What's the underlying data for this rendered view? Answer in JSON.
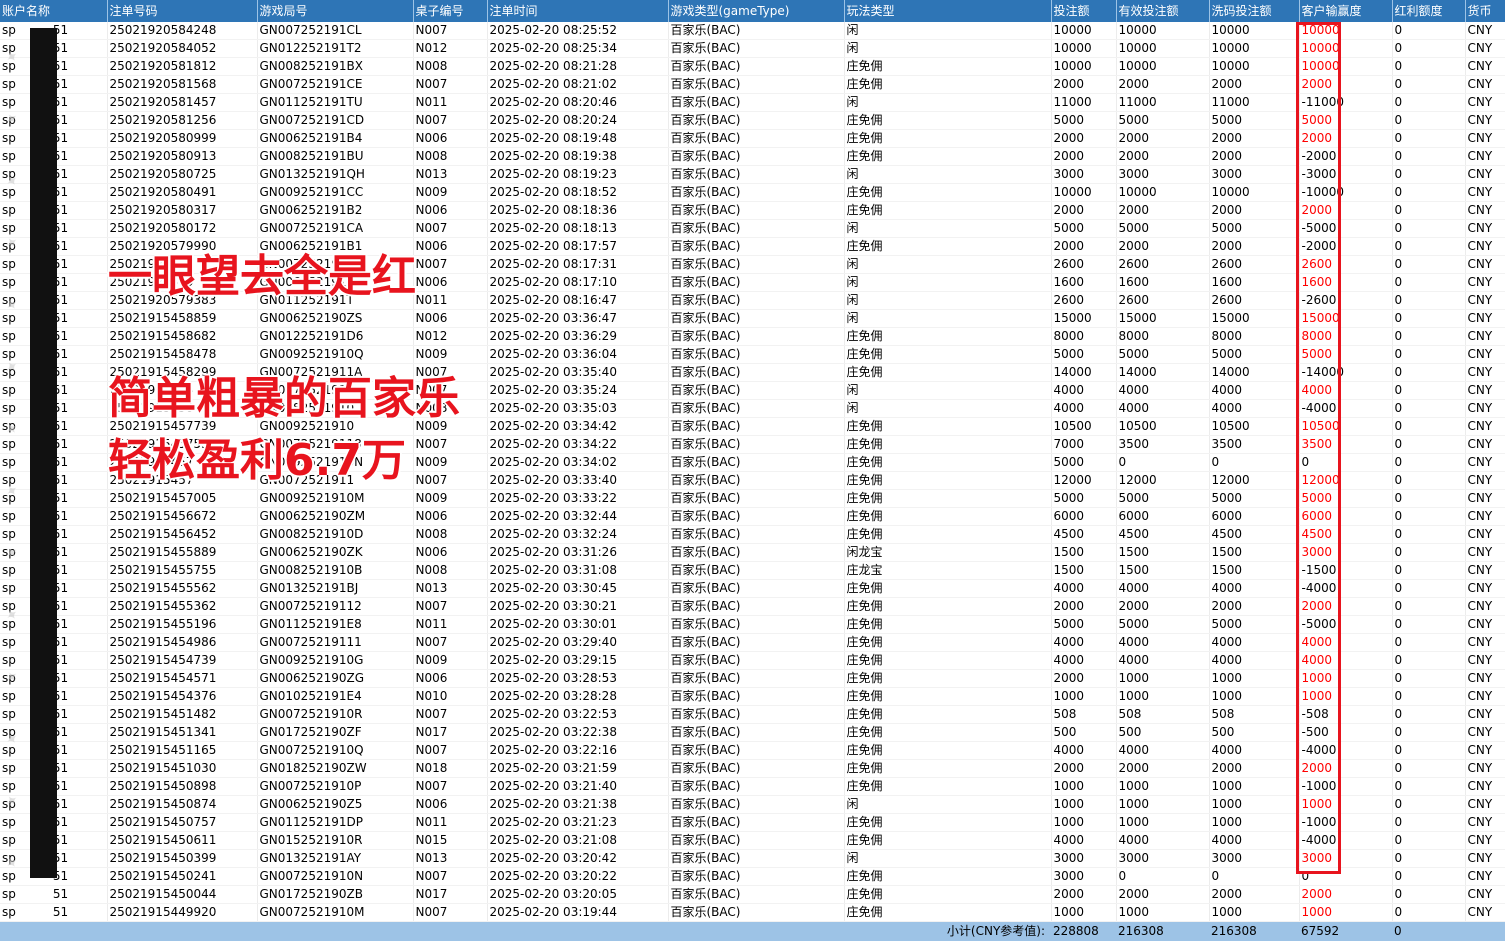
{
  "columns": [
    "账户名称",
    "注单号码",
    "游戏局号",
    "桌子编号",
    "注单时间",
    "游戏类型(gameType)",
    "玩法类型",
    "投注额",
    "有效投注额",
    "洗码投注额",
    "客户输赢度",
    "红利额度",
    "货币"
  ],
  "rows": [
    {
      "acct": "sp",
      "suffix": "51",
      "bet_no": "25021920584248",
      "round": "GN007252191CL",
      "table": "N007",
      "time": "2025-02-20 08:25:52",
      "game": "百家乐(BAC)",
      "play": "闲",
      "bet": "10000",
      "valid": "10000",
      "wash": "10000",
      "winloss": "10000",
      "bonus": "0",
      "currency": "CNY"
    },
    {
      "acct": "sp",
      "suffix": "51",
      "bet_no": "25021920584052",
      "round": "GN012252191T2",
      "table": "N012",
      "time": "2025-02-20 08:25:34",
      "game": "百家乐(BAC)",
      "play": "闲",
      "bet": "10000",
      "valid": "10000",
      "wash": "10000",
      "winloss": "10000",
      "bonus": "0",
      "currency": "CNY"
    },
    {
      "acct": "sp",
      "suffix": "51",
      "bet_no": "25021920581812",
      "round": "GN008252191BX",
      "table": "N008",
      "time": "2025-02-20 08:21:28",
      "game": "百家乐(BAC)",
      "play": "庄免佣",
      "bet": "10000",
      "valid": "10000",
      "wash": "10000",
      "winloss": "10000",
      "bonus": "0",
      "currency": "CNY"
    },
    {
      "acct": "sp",
      "suffix": "51",
      "bet_no": "25021920581568",
      "round": "GN007252191CE",
      "table": "N007",
      "time": "2025-02-20 08:21:02",
      "game": "百家乐(BAC)",
      "play": "庄免佣",
      "bet": "2000",
      "valid": "2000",
      "wash": "2000",
      "winloss": "2000",
      "bonus": "0",
      "currency": "CNY"
    },
    {
      "acct": "sp",
      "suffix": "51",
      "bet_no": "25021920581457",
      "round": "GN011252191TU",
      "table": "N011",
      "time": "2025-02-20 08:20:46",
      "game": "百家乐(BAC)",
      "play": "闲",
      "bet": "11000",
      "valid": "11000",
      "wash": "11000",
      "winloss": "-11000",
      "bonus": "0",
      "currency": "CNY"
    },
    {
      "acct": "sp",
      "suffix": "51",
      "bet_no": "25021920581256",
      "round": "GN007252191CD",
      "table": "N007",
      "time": "2025-02-20 08:20:24",
      "game": "百家乐(BAC)",
      "play": "庄免佣",
      "bet": "5000",
      "valid": "5000",
      "wash": "5000",
      "winloss": "5000",
      "bonus": "0",
      "currency": "CNY"
    },
    {
      "acct": "sp",
      "suffix": "51",
      "bet_no": "25021920580999",
      "round": "GN006252191B4",
      "table": "N006",
      "time": "2025-02-20 08:19:48",
      "game": "百家乐(BAC)",
      "play": "庄免佣",
      "bet": "2000",
      "valid": "2000",
      "wash": "2000",
      "winloss": "2000",
      "bonus": "0",
      "currency": "CNY"
    },
    {
      "acct": "sp",
      "suffix": "51",
      "bet_no": "25021920580913",
      "round": "GN008252191BU",
      "table": "N008",
      "time": "2025-02-20 08:19:38",
      "game": "百家乐(BAC)",
      "play": "庄免佣",
      "bet": "2000",
      "valid": "2000",
      "wash": "2000",
      "winloss": "-2000",
      "bonus": "0",
      "currency": "CNY"
    },
    {
      "acct": "sp",
      "suffix": "51",
      "bet_no": "25021920580725",
      "round": "GN013252191QH",
      "table": "N013",
      "time": "2025-02-20 08:19:23",
      "game": "百家乐(BAC)",
      "play": "闲",
      "bet": "3000",
      "valid": "3000",
      "wash": "3000",
      "winloss": "-3000",
      "bonus": "0",
      "currency": "CNY"
    },
    {
      "acct": "sp",
      "suffix": "51",
      "bet_no": "25021920580491",
      "round": "GN009252191CC",
      "table": "N009",
      "time": "2025-02-20 08:18:52",
      "game": "百家乐(BAC)",
      "play": "庄免佣",
      "bet": "10000",
      "valid": "10000",
      "wash": "10000",
      "winloss": "-10000",
      "bonus": "0",
      "currency": "CNY"
    },
    {
      "acct": "sp",
      "suffix": "51",
      "bet_no": "25021920580317",
      "round": "GN006252191B2",
      "table": "N006",
      "time": "2025-02-20 08:18:36",
      "game": "百家乐(BAC)",
      "play": "庄免佣",
      "bet": "2000",
      "valid": "2000",
      "wash": "2000",
      "winloss": "2000",
      "bonus": "0",
      "currency": "CNY"
    },
    {
      "acct": "sp",
      "suffix": "51",
      "bet_no": "25021920580172",
      "round": "GN007252191CA",
      "table": "N007",
      "time": "2025-02-20 08:18:13",
      "game": "百家乐(BAC)",
      "play": "闲",
      "bet": "5000",
      "valid": "5000",
      "wash": "5000",
      "winloss": "-5000",
      "bonus": "0",
      "currency": "CNY"
    },
    {
      "acct": "sp",
      "suffix": "51",
      "bet_no": "25021920579990",
      "round": "GN006252191B1",
      "table": "N006",
      "time": "2025-02-20 08:17:57",
      "game": "百家乐(BAC)",
      "play": "庄免佣",
      "bet": "2000",
      "valid": "2000",
      "wash": "2000",
      "winloss": "-2000",
      "bonus": "0",
      "currency": "CNY"
    },
    {
      "acct": "sp",
      "suffix": "51",
      "bet_no": "25021920579",
      "round": "GN007252191C",
      "table": "N007",
      "time": "2025-02-20 08:17:31",
      "game": "百家乐(BAC)",
      "play": "闲",
      "bet": "2600",
      "valid": "2600",
      "wash": "2600",
      "winloss": "2600",
      "bonus": "0",
      "currency": "CNY"
    },
    {
      "acct": "sp",
      "suffix": "51",
      "bet_no": "25021920579",
      "round": "GN006252191B",
      "table": "N006",
      "time": "2025-02-20 08:17:10",
      "game": "百家乐(BAC)",
      "play": "闲",
      "bet": "1600",
      "valid": "1600",
      "wash": "1600",
      "winloss": "1600",
      "bonus": "0",
      "currency": "CNY"
    },
    {
      "acct": "sp",
      "suffix": "51",
      "bet_no": "25021920579383",
      "round": "GN011252191T",
      "table": "N011",
      "time": "2025-02-20 08:16:47",
      "game": "百家乐(BAC)",
      "play": "闲",
      "bet": "2600",
      "valid": "2600",
      "wash": "2600",
      "winloss": "-2600",
      "bonus": "0",
      "currency": "CNY"
    },
    {
      "acct": "sp",
      "suffix": "51",
      "bet_no": "25021915458859",
      "round": "GN006252190ZS",
      "table": "N006",
      "time": "2025-02-20 03:36:47",
      "game": "百家乐(BAC)",
      "play": "闲",
      "bet": "15000",
      "valid": "15000",
      "wash": "15000",
      "winloss": "15000",
      "bonus": "0",
      "currency": "CNY"
    },
    {
      "acct": "sp",
      "suffix": "51",
      "bet_no": "25021915458682",
      "round": "GN012252191D6",
      "table": "N012",
      "time": "2025-02-20 03:36:29",
      "game": "百家乐(BAC)",
      "play": "庄免佣",
      "bet": "8000",
      "valid": "8000",
      "wash": "8000",
      "winloss": "8000",
      "bonus": "0",
      "currency": "CNY"
    },
    {
      "acct": "sp",
      "suffix": "51",
      "bet_no": "25021915458478",
      "round": "GN0092521910Q",
      "table": "N009",
      "time": "2025-02-20 03:36:04",
      "game": "百家乐(BAC)",
      "play": "庄免佣",
      "bet": "5000",
      "valid": "5000",
      "wash": "5000",
      "winloss": "5000",
      "bonus": "0",
      "currency": "CNY"
    },
    {
      "acct": "sp",
      "suffix": "51",
      "bet_no": "25021915458299",
      "round": "GN0072521911A",
      "table": "N007",
      "time": "2025-02-20 03:35:40",
      "game": "百家乐(BAC)",
      "play": "庄免佣",
      "bet": "14000",
      "valid": "14000",
      "wash": "14000",
      "winloss": "-14000",
      "bonus": "0",
      "currency": "CNY"
    },
    {
      "acct": "sp",
      "suffix": "51",
      "bet_no": "25021915458",
      "round": "GN0072521911",
      "table": "N007",
      "time": "2025-02-20 03:35:24",
      "game": "百家乐(BAC)",
      "play": "闲",
      "bet": "4000",
      "valid": "4000",
      "wash": "4000",
      "winloss": "4000",
      "bonus": "0",
      "currency": "CNY"
    },
    {
      "acct": "sp",
      "suffix": "51",
      "bet_no": "25021915458",
      "round": "GN0082521910",
      "table": "N008",
      "time": "2025-02-20 03:35:03",
      "game": "百家乐(BAC)",
      "play": "闲",
      "bet": "4000",
      "valid": "4000",
      "wash": "4000",
      "winloss": "-4000",
      "bonus": "0",
      "currency": "CNY"
    },
    {
      "acct": "sp",
      "suffix": "51",
      "bet_no": "25021915457739",
      "round": "GN0092521910",
      "table": "N009",
      "time": "2025-02-20 03:34:42",
      "game": "百家乐(BAC)",
      "play": "庄免佣",
      "bet": "10500",
      "valid": "10500",
      "wash": "10500",
      "winloss": "10500",
      "bonus": "0",
      "currency": "CNY"
    },
    {
      "acct": "sp",
      "suffix": "51",
      "bet_no": "25021915457534",
      "round": "GN00725219118",
      "table": "N007",
      "time": "2025-02-20 03:34:22",
      "game": "百家乐(BAC)",
      "play": "庄免佣",
      "bet": "7000",
      "valid": "3500",
      "wash": "3500",
      "winloss": "3500",
      "bonus": "0",
      "currency": "CNY"
    },
    {
      "acct": "sp",
      "suffix": "51",
      "bet_no": "25021915457",
      "round": "GN0092521910N",
      "table": "N009",
      "time": "2025-02-20 03:34:02",
      "game": "百家乐(BAC)",
      "play": "庄免佣",
      "bet": "5000",
      "valid": "0",
      "wash": "0",
      "winloss": "0",
      "bonus": "0",
      "currency": "CNY"
    },
    {
      "acct": "sp",
      "suffix": "51",
      "bet_no": "25021915457",
      "round": "GN0072521911",
      "table": "N007",
      "time": "2025-02-20 03:33:40",
      "game": "百家乐(BAC)",
      "play": "庄免佣",
      "bet": "12000",
      "valid": "12000",
      "wash": "12000",
      "winloss": "12000",
      "bonus": "0",
      "currency": "CNY"
    },
    {
      "acct": "sp",
      "suffix": "51",
      "bet_no": "25021915457005",
      "round": "GN0092521910M",
      "table": "N009",
      "time": "2025-02-20 03:33:22",
      "game": "百家乐(BAC)",
      "play": "庄免佣",
      "bet": "5000",
      "valid": "5000",
      "wash": "5000",
      "winloss": "5000",
      "bonus": "0",
      "currency": "CNY"
    },
    {
      "acct": "sp",
      "suffix": "51",
      "bet_no": "25021915456672",
      "round": "GN006252190ZM",
      "table": "N006",
      "time": "2025-02-20 03:32:44",
      "game": "百家乐(BAC)",
      "play": "庄免佣",
      "bet": "6000",
      "valid": "6000",
      "wash": "6000",
      "winloss": "6000",
      "bonus": "0",
      "currency": "CNY"
    },
    {
      "acct": "sp",
      "suffix": "51",
      "bet_no": "25021915456452",
      "round": "GN0082521910D",
      "table": "N008",
      "time": "2025-02-20 03:32:24",
      "game": "百家乐(BAC)",
      "play": "庄免佣",
      "bet": "4500",
      "valid": "4500",
      "wash": "4500",
      "winloss": "4500",
      "bonus": "0",
      "currency": "CNY"
    },
    {
      "acct": "sp",
      "suffix": "51",
      "bet_no": "25021915455889",
      "round": "GN006252190ZK",
      "table": "N006",
      "time": "2025-02-20 03:31:26",
      "game": "百家乐(BAC)",
      "play": "闲龙宝",
      "bet": "1500",
      "valid": "1500",
      "wash": "1500",
      "winloss": "3000",
      "bonus": "0",
      "currency": "CNY"
    },
    {
      "acct": "sp",
      "suffix": "51",
      "bet_no": "25021915455755",
      "round": "GN0082521910B",
      "table": "N008",
      "time": "2025-02-20 03:31:08",
      "game": "百家乐(BAC)",
      "play": "庄龙宝",
      "bet": "1500",
      "valid": "1500",
      "wash": "1500",
      "winloss": "-1500",
      "bonus": "0",
      "currency": "CNY"
    },
    {
      "acct": "sp",
      "suffix": "51",
      "bet_no": "25021915455562",
      "round": "GN013252191BJ",
      "table": "N013",
      "time": "2025-02-20 03:30:45",
      "game": "百家乐(BAC)",
      "play": "庄免佣",
      "bet": "4000",
      "valid": "4000",
      "wash": "4000",
      "winloss": "-4000",
      "bonus": "0",
      "currency": "CNY"
    },
    {
      "acct": "sp",
      "suffix": "51",
      "bet_no": "25021915455362",
      "round": "GN00725219112",
      "table": "N007",
      "time": "2025-02-20 03:30:21",
      "game": "百家乐(BAC)",
      "play": "庄免佣",
      "bet": "2000",
      "valid": "2000",
      "wash": "2000",
      "winloss": "2000",
      "bonus": "0",
      "currency": "CNY"
    },
    {
      "acct": "sp",
      "suffix": "51",
      "bet_no": "25021915455196",
      "round": "GN011252191E8",
      "table": "N011",
      "time": "2025-02-20 03:30:01",
      "game": "百家乐(BAC)",
      "play": "庄免佣",
      "bet": "5000",
      "valid": "5000",
      "wash": "5000",
      "winloss": "-5000",
      "bonus": "0",
      "currency": "CNY"
    },
    {
      "acct": "sp",
      "suffix": "51",
      "bet_no": "25021915454986",
      "round": "GN00725219111",
      "table": "N007",
      "time": "2025-02-20 03:29:40",
      "game": "百家乐(BAC)",
      "play": "庄免佣",
      "bet": "4000",
      "valid": "4000",
      "wash": "4000",
      "winloss": "4000",
      "bonus": "0",
      "currency": "CNY"
    },
    {
      "acct": "sp",
      "suffix": "51",
      "bet_no": "25021915454739",
      "round": "GN0092521910G",
      "table": "N009",
      "time": "2025-02-20 03:29:15",
      "game": "百家乐(BAC)",
      "play": "庄免佣",
      "bet": "4000",
      "valid": "4000",
      "wash": "4000",
      "winloss": "4000",
      "bonus": "0",
      "currency": "CNY"
    },
    {
      "acct": "sp",
      "suffix": "51",
      "bet_no": "25021915454571",
      "round": "GN006252190ZG",
      "table": "N006",
      "time": "2025-02-20 03:28:53",
      "game": "百家乐(BAC)",
      "play": "庄免佣",
      "bet": "2000",
      "valid": "1000",
      "wash": "1000",
      "winloss": "1000",
      "bonus": "0",
      "currency": "CNY"
    },
    {
      "acct": "sp",
      "suffix": "51",
      "bet_no": "25021915454376",
      "round": "GN010252191E4",
      "table": "N010",
      "time": "2025-02-20 03:28:28",
      "game": "百家乐(BAC)",
      "play": "庄免佣",
      "bet": "1000",
      "valid": "1000",
      "wash": "1000",
      "winloss": "1000",
      "bonus": "0",
      "currency": "CNY"
    },
    {
      "acct": "sp",
      "suffix": "51",
      "bet_no": "25021915451482",
      "round": "GN0072521910R",
      "table": "N007",
      "time": "2025-02-20 03:22:53",
      "game": "百家乐(BAC)",
      "play": "庄免佣",
      "bet": "508",
      "valid": "508",
      "wash": "508",
      "winloss": "-508",
      "bonus": "0",
      "currency": "CNY"
    },
    {
      "acct": "sp",
      "suffix": "51",
      "bet_no": "25021915451341",
      "round": "GN017252190ZF",
      "table": "N017",
      "time": "2025-02-20 03:22:38",
      "game": "百家乐(BAC)",
      "play": "庄免佣",
      "bet": "500",
      "valid": "500",
      "wash": "500",
      "winloss": "-500",
      "bonus": "0",
      "currency": "CNY"
    },
    {
      "acct": "sp",
      "suffix": "51",
      "bet_no": "25021915451165",
      "round": "GN0072521910Q",
      "table": "N007",
      "time": "2025-02-20 03:22:16",
      "game": "百家乐(BAC)",
      "play": "庄免佣",
      "bet": "4000",
      "valid": "4000",
      "wash": "4000",
      "winloss": "-4000",
      "bonus": "0",
      "currency": "CNY"
    },
    {
      "acct": "sp",
      "suffix": "51",
      "bet_no": "25021915451030",
      "round": "GN018252190ZW",
      "table": "N018",
      "time": "2025-02-20 03:21:59",
      "game": "百家乐(BAC)",
      "play": "庄免佣",
      "bet": "2000",
      "valid": "2000",
      "wash": "2000",
      "winloss": "2000",
      "bonus": "0",
      "currency": "CNY"
    },
    {
      "acct": "sp",
      "suffix": "51",
      "bet_no": "25021915450898",
      "round": "GN0072521910P",
      "table": "N007",
      "time": "2025-02-20 03:21:40",
      "game": "百家乐(BAC)",
      "play": "庄免佣",
      "bet": "1000",
      "valid": "1000",
      "wash": "1000",
      "winloss": "-1000",
      "bonus": "0",
      "currency": "CNY"
    },
    {
      "acct": "sp",
      "suffix": "51",
      "bet_no": "25021915450874",
      "round": "GN006252190Z5",
      "table": "N006",
      "time": "2025-02-20 03:21:38",
      "game": "百家乐(BAC)",
      "play": "闲",
      "bet": "1000",
      "valid": "1000",
      "wash": "1000",
      "winloss": "1000",
      "bonus": "0",
      "currency": "CNY"
    },
    {
      "acct": "sp",
      "suffix": "51",
      "bet_no": "25021915450757",
      "round": "GN011252191DP",
      "table": "N011",
      "time": "2025-02-20 03:21:23",
      "game": "百家乐(BAC)",
      "play": "庄免佣",
      "bet": "1000",
      "valid": "1000",
      "wash": "1000",
      "winloss": "-1000",
      "bonus": "0",
      "currency": "CNY"
    },
    {
      "acct": "sp",
      "suffix": "51",
      "bet_no": "25021915450611",
      "round": "GN0152521910R",
      "table": "N015",
      "time": "2025-02-20 03:21:08",
      "game": "百家乐(BAC)",
      "play": "庄免佣",
      "bet": "4000",
      "valid": "4000",
      "wash": "4000",
      "winloss": "-4000",
      "bonus": "0",
      "currency": "CNY"
    },
    {
      "acct": "sp",
      "suffix": "51",
      "bet_no": "25021915450399",
      "round": "GN013252191AY",
      "table": "N013",
      "time": "2025-02-20 03:20:42",
      "game": "百家乐(BAC)",
      "play": "闲",
      "bet": "3000",
      "valid": "3000",
      "wash": "3000",
      "winloss": "3000",
      "bonus": "0",
      "currency": "CNY"
    },
    {
      "acct": "sp",
      "suffix": "51",
      "bet_no": "25021915450241",
      "round": "GN0072521910N",
      "table": "N007",
      "time": "2025-02-20 03:20:22",
      "game": "百家乐(BAC)",
      "play": "庄免佣",
      "bet": "3000",
      "valid": "0",
      "wash": "0",
      "winloss": "0",
      "bonus": "0",
      "currency": "CNY"
    },
    {
      "acct": "sp",
      "suffix": "51",
      "bet_no": "25021915450044",
      "round": "GN017252190ZB",
      "table": "N017",
      "time": "2025-02-20 03:20:05",
      "game": "百家乐(BAC)",
      "play": "庄免佣",
      "bet": "2000",
      "valid": "2000",
      "wash": "2000",
      "winloss": "2000",
      "bonus": "0",
      "currency": "CNY"
    },
    {
      "acct": "sp",
      "suffix": "51",
      "bet_no": "25021915449920",
      "round": "GN0072521910M",
      "table": "N007",
      "time": "2025-02-20 03:19:44",
      "game": "百家乐(BAC)",
      "play": "庄免佣",
      "bet": "1000",
      "valid": "1000",
      "wash": "1000",
      "winloss": "1000",
      "bonus": "0",
      "currency": "CNY"
    }
  ],
  "footer": {
    "label": "小计(CNY参考值):",
    "bet": "228808",
    "valid": "216308",
    "wash": "216308",
    "winloss": "67592",
    "bonus": "0"
  },
  "overlay": {
    "line1": "一眼望去全是红",
    "line2": "简单粗暴的百家乐",
    "line3": "轻松盈利6.7万"
  },
  "colors": {
    "header_bg": "#2e75b6",
    "footer_bg": "#9dc3e6",
    "highlight": "#e8141e",
    "positive_text": "#ff0000"
  }
}
